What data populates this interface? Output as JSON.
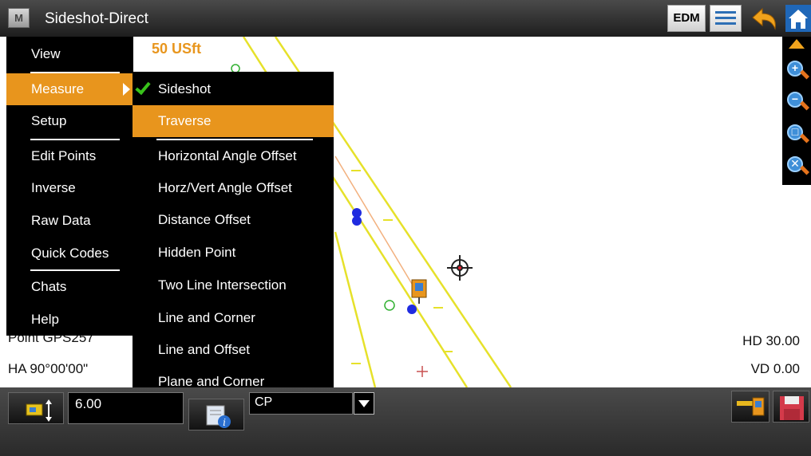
{
  "titlebar": {
    "app_icon": "M",
    "title": "Sideshot-Direct",
    "edm_label": "EDM",
    "icons": [
      "list-view-icon",
      "back-arrow-icon",
      "home-icon"
    ]
  },
  "map": {
    "scale_label": "50 USft",
    "zoom_icons": [
      "pan-up-icon",
      "zoom-in-icon",
      "zoom-out-icon",
      "zoom-window-icon",
      "zoom-extents-icon"
    ],
    "zoom_glyphs": {
      "in": "+",
      "out": "−",
      "window": "□",
      "extents": "✕"
    },
    "point_label": "Point GPS257",
    "ha_label": "HA 90°00'00\"",
    "hd_label": "HD 30.00",
    "vd_label": "VD 0.00"
  },
  "main_menu": {
    "items": [
      {
        "label": "View"
      },
      {
        "label": "Measure",
        "active": true,
        "has_submenu": true
      },
      {
        "label": "Setup"
      },
      {
        "label": "Edit Points"
      },
      {
        "label": "Inverse"
      },
      {
        "label": "Raw Data"
      },
      {
        "label": "Quick Codes"
      },
      {
        "label": "Chats"
      },
      {
        "label": "Help"
      }
    ]
  },
  "sub_menu": {
    "items": [
      {
        "label": "Sideshot",
        "checked": true
      },
      {
        "label": "Traverse",
        "active": true
      },
      {
        "label": "Horizontal Angle Offset"
      },
      {
        "label": "Horz/Vert Angle Offset"
      },
      {
        "label": "Distance Offset"
      },
      {
        "label": "Hidden Point"
      },
      {
        "label": "Two Line Intersection"
      },
      {
        "label": "Line and Corner"
      },
      {
        "label": "Line and Offset"
      },
      {
        "label": "Plane and Corner"
      }
    ]
  },
  "bottombar": {
    "height_value": "6.00",
    "code_value": "CP",
    "icons": [
      "rod-height-icon",
      "point-info-icon",
      "measure-icon",
      "save-icon"
    ]
  },
  "colors": {
    "accent": "#e8951d",
    "check": "#39c21b",
    "map_line": "#e6e12a",
    "point_blue": "#1f2be0"
  }
}
